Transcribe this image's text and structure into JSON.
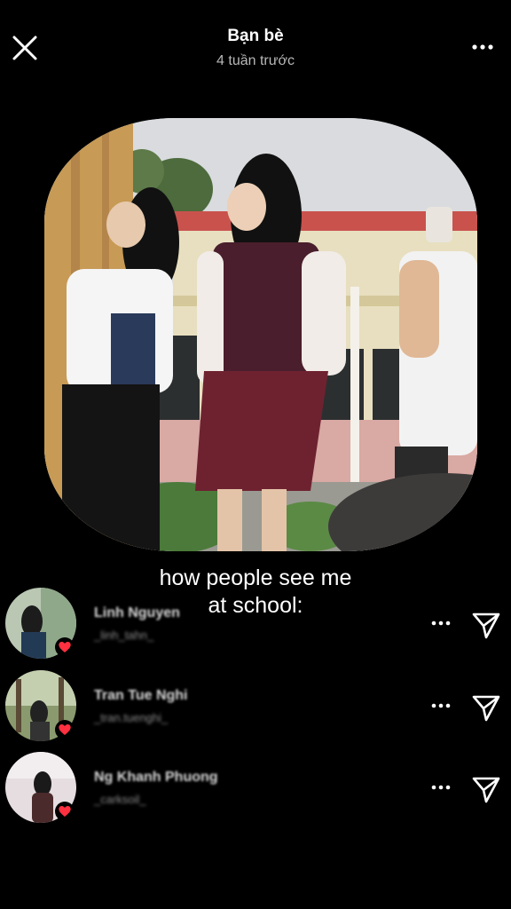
{
  "header": {
    "title": "Bạn bè",
    "subtitle": "4 tuần trước",
    "close_icon": "close-icon",
    "more_icon": "more-horizontal-icon"
  },
  "post": {
    "caption_line1": "how people see me",
    "caption_line2": "at school:"
  },
  "friends": [
    {
      "name": "Linh Nguyen",
      "handle": "_linh_tahn_",
      "reaction": "heart"
    },
    {
      "name": "Tran Tue Nghi",
      "handle": "_tran.tuenghi_",
      "reaction": "heart"
    },
    {
      "name": "Ng Khanh Phuong",
      "handle": "_carksoil_",
      "reaction": "heart"
    }
  ],
  "colors": {
    "background": "#000000",
    "heart": "#ff3040",
    "subtitle": "#b8b8b8"
  }
}
